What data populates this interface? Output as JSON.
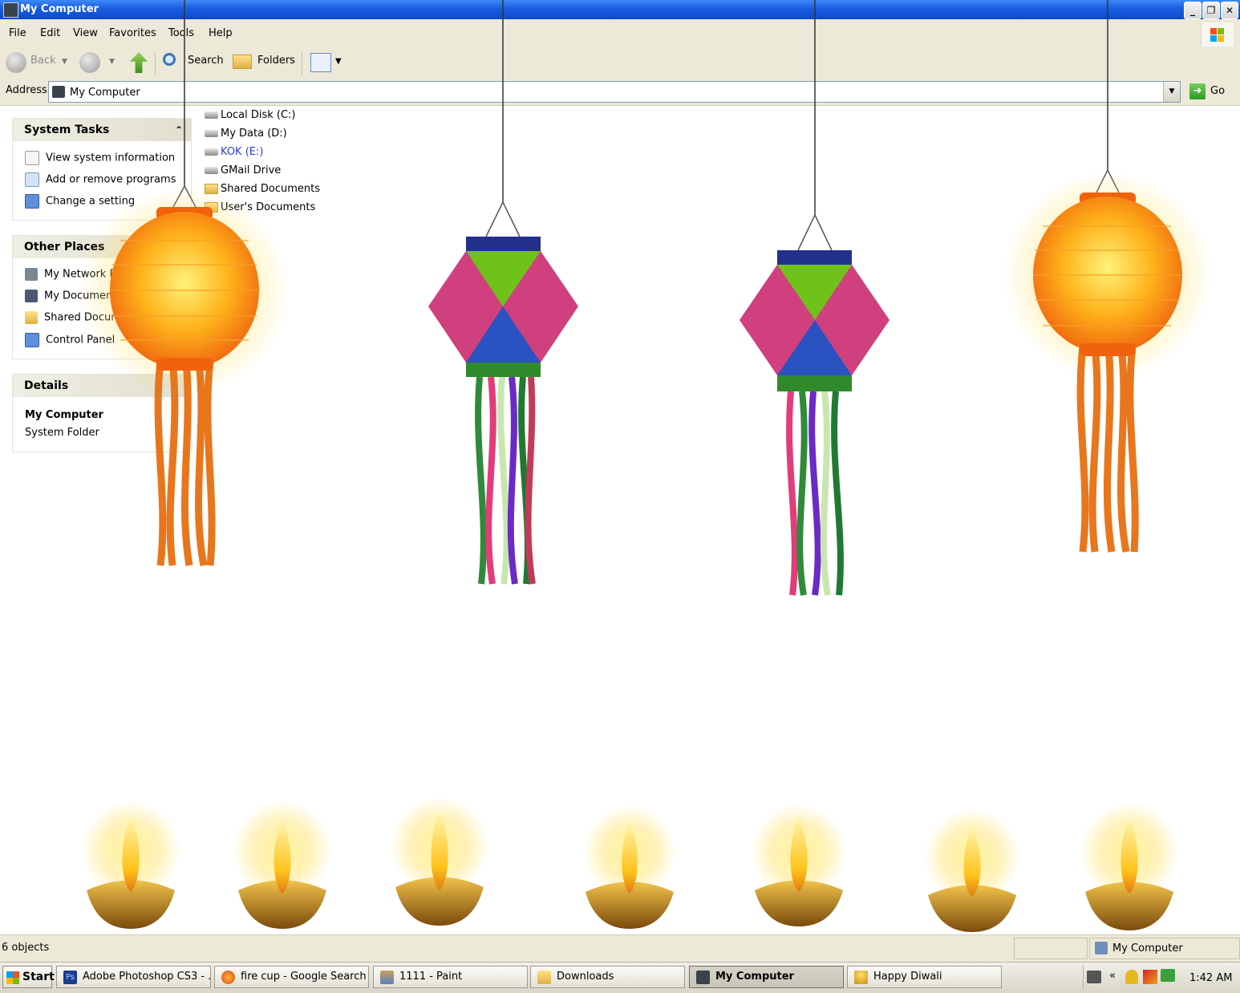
{
  "window": {
    "title": "My Computer"
  },
  "menu": [
    "File",
    "Edit",
    "View",
    "Favorites",
    "Tools",
    "Help"
  ],
  "toolbar": {
    "back": "Back",
    "search": "Search",
    "folders": "Folders"
  },
  "address": {
    "label": "Address",
    "value": "My Computer",
    "go": "Go"
  },
  "sidebar": {
    "system_tasks": {
      "title": "System Tasks",
      "items": [
        "View system information",
        "Add or remove programs",
        "Change a setting"
      ]
    },
    "other_places": {
      "title": "Other Places",
      "items": [
        "My Network Pl",
        "My Document",
        "Shared Docume",
        "Control Panel"
      ]
    },
    "details": {
      "title": "Details",
      "name": "My Computer",
      "type": "System Folder"
    }
  },
  "drives": [
    {
      "label": "Local Disk (C:)",
      "kind": "drive"
    },
    {
      "label": "My Data (D:)",
      "kind": "drive"
    },
    {
      "label": "KOK (E:)",
      "kind": "drive",
      "color": "#2a3fd8"
    },
    {
      "label": "GMail Drive",
      "kind": "drive"
    },
    {
      "label": "Shared Documents",
      "kind": "folder"
    },
    {
      "label": "User's Documents",
      "kind": "folder"
    }
  ],
  "statusbar": {
    "objects": "6 objects",
    "location": "My Computer"
  },
  "taskbar": {
    "start": "Start",
    "tasks": [
      {
        "label": "Adobe Photoshop CS3 - ...",
        "icon": "photoshop-icon",
        "active": false
      },
      {
        "label": "fire cup - Google Search ...",
        "icon": "firefox-icon",
        "active": false
      },
      {
        "label": "1111 - Paint",
        "icon": "paint-icon",
        "active": false
      },
      {
        "label": "Downloads",
        "icon": "folder-icon",
        "active": false
      },
      {
        "label": "My Computer",
        "icon": "computer-icon",
        "active": true
      },
      {
        "label": "Happy Diwali",
        "icon": "diya-icon",
        "active": false
      }
    ],
    "clock": "1:42 AM"
  },
  "decor": {
    "orange_lantern": "#ff8c1a",
    "kandil_pink": "#d8307a",
    "diya_gold": "#c8901c"
  }
}
